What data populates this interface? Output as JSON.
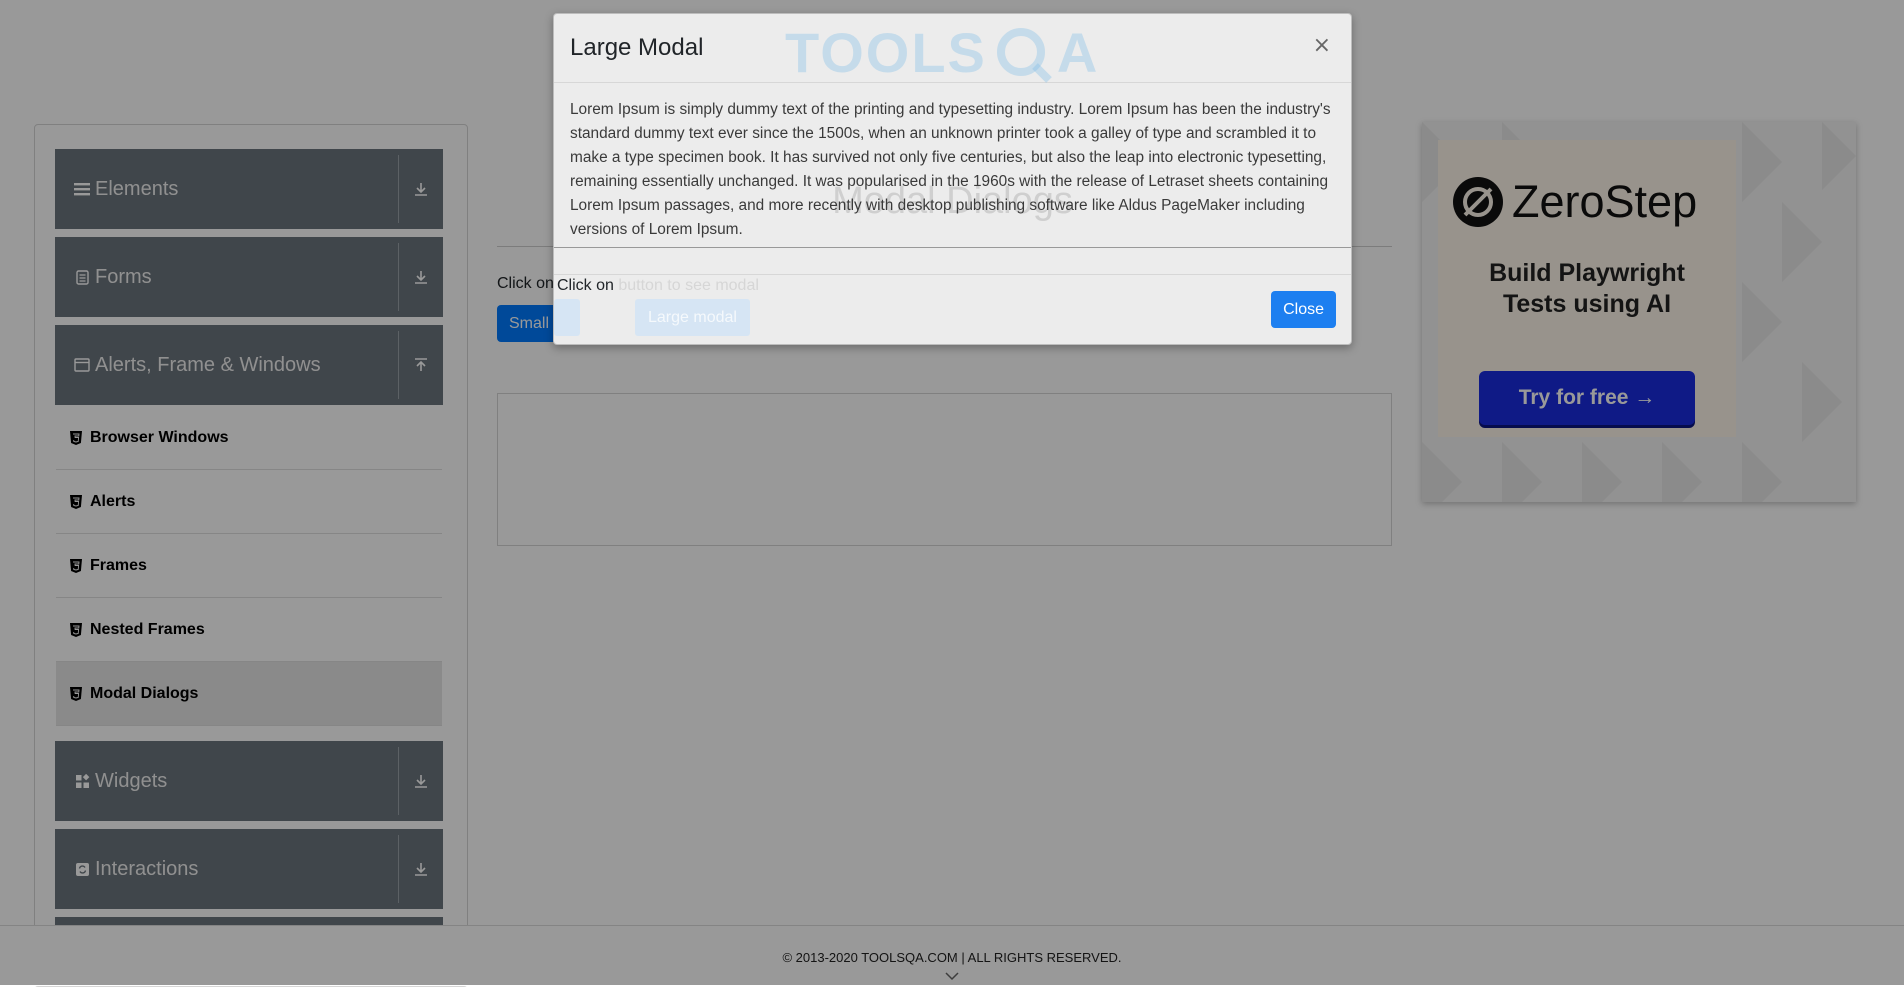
{
  "header": {
    "logo_text_left": "TOOLS",
    "logo_text_right": "A"
  },
  "sidebar": {
    "groups": [
      {
        "label": "Elements",
        "icon": "hamburger-icon",
        "state": "collapsed"
      },
      {
        "label": "Forms",
        "icon": "document-icon",
        "state": "collapsed"
      },
      {
        "label": "Alerts, Frame & Windows",
        "icon": "window-icon",
        "state": "expanded"
      },
      {
        "label": "Widgets",
        "icon": "widgets-icon",
        "state": "collapsed"
      },
      {
        "label": "Interactions",
        "icon": "interactions-icon",
        "state": "collapsed"
      }
    ],
    "sub_items": [
      {
        "label": "Browser Windows"
      },
      {
        "label": "Alerts"
      },
      {
        "label": "Frames"
      },
      {
        "label": "Nested Frames"
      },
      {
        "label": "Modal Dialogs",
        "active": true
      }
    ]
  },
  "main": {
    "title": "Modal Dialogs",
    "instruction": "Click on button to see modal",
    "small_modal_label": "Small modal",
    "large_modal_label": "Large modal"
  },
  "ad": {
    "brand": "ZeroStep",
    "headline_line1": "Build Playwright",
    "headline_line2": "Tests using AI",
    "cta": "Try for free →"
  },
  "footer": {
    "text": "© 2013-2020 TOOLSQA.COM | ALL RIGHTS RESERVED."
  },
  "modal": {
    "title": "Large Modal",
    "close_symbol": "×",
    "body": "Lorem Ipsum is simply dummy text of the printing and typesetting industry. Lorem Ipsum has been the industry's standard dummy text ever since the 1500s, when an unknown printer took a galley of type and scrambled it to make a type specimen book. It has survived not only five centuries, but also the leap into electronic typesetting, remaining essentially unchanged. It was popularised in the 1960s with the release of Letraset sheets containing Lorem Ipsum passages, and more recently with desktop publishing software like Aldus PageMaker including versions of Lorem Ipsum.",
    "close_button": "Close"
  },
  "colors": {
    "primary": "#007bff",
    "sidebar_group": "#6c757d",
    "ad_cta": "#1a2cdf",
    "backdrop": "rgba(0,0,0,0.4)"
  }
}
